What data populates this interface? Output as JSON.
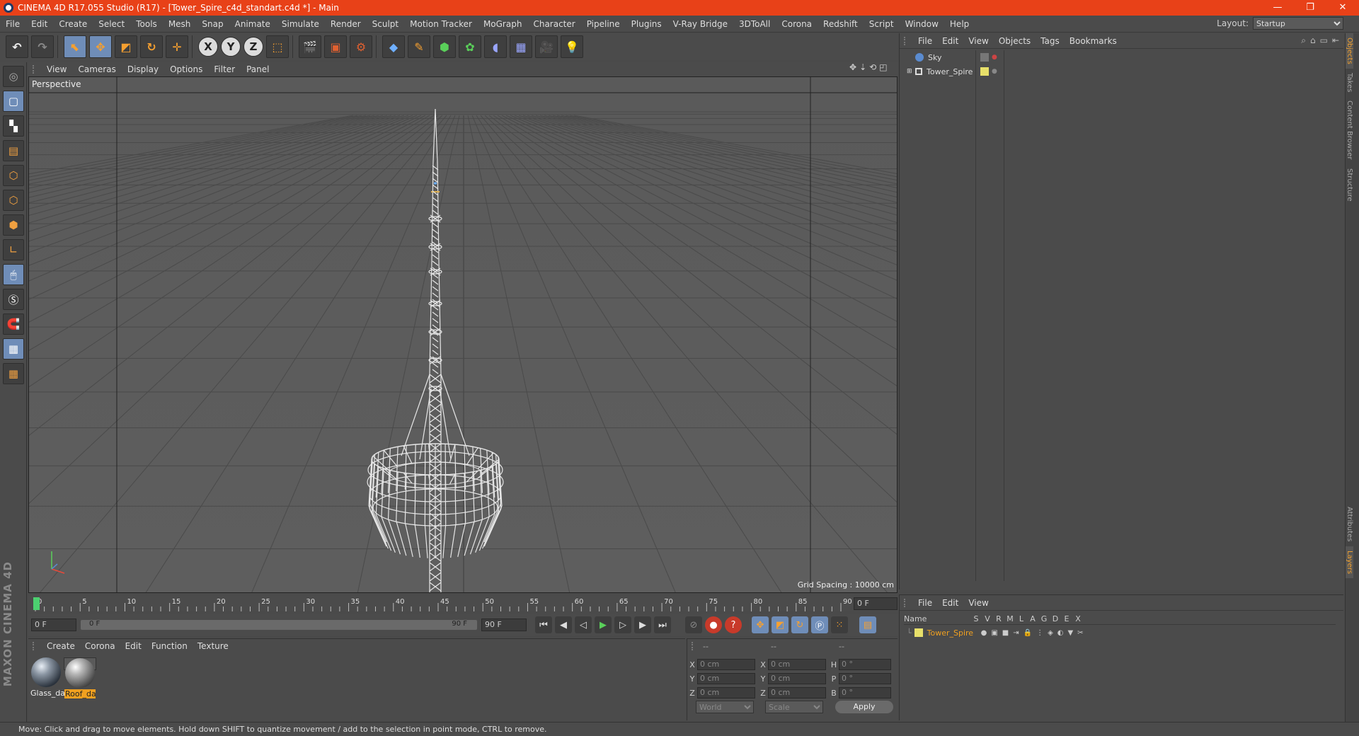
{
  "window": {
    "title": "CINEMA 4D R17.055 Studio (R17) - [Tower_Spire_c4d_standart.c4d *] - Main",
    "controls": [
      "—",
      "❐",
      "✕"
    ]
  },
  "menu": [
    "File",
    "Edit",
    "Create",
    "Select",
    "Tools",
    "Mesh",
    "Snap",
    "Animate",
    "Simulate",
    "Render",
    "Sculpt",
    "Motion Tracker",
    "MoGraph",
    "Character",
    "Pipeline",
    "Plugins",
    "V-Ray Bridge",
    "3DToAll",
    "Corona",
    "Redshift",
    "Script",
    "Window",
    "Help"
  ],
  "layout": {
    "label": "Layout:",
    "value": "Startup"
  },
  "toolbar": {
    "axis_x": "X",
    "axis_y": "Y",
    "axis_z": "Z"
  },
  "viewport": {
    "menu": [
      "View",
      "Cameras",
      "Display",
      "Options",
      "Filter",
      "Panel"
    ],
    "label": "Perspective",
    "grid_spacing": "Grid Spacing : 10000 cm"
  },
  "timeline": {
    "ticks": [
      "0",
      "5",
      "10",
      "15",
      "20",
      "25",
      "30",
      "35",
      "40",
      "45",
      "50",
      "55",
      "60",
      "65",
      "70",
      "75",
      "80",
      "85",
      "90"
    ],
    "current_frame": "0 F",
    "start_field": "0 F",
    "range_start": "0 F",
    "range_end": "90 F",
    "end_field": "90 F"
  },
  "materials": {
    "menu": [
      "Create",
      "Corona",
      "Edit",
      "Function",
      "Texture"
    ],
    "items": [
      {
        "name": "Glass_da"
      },
      {
        "name": "Roof_da"
      }
    ]
  },
  "coordinates": {
    "header": [
      "--",
      "--",
      "--"
    ],
    "rows": [
      {
        "a": "X",
        "av": "0 cm",
        "b": "X",
        "bv": "0 cm",
        "c": "H",
        "cv": "0 °"
      },
      {
        "a": "Y",
        "av": "0 cm",
        "b": "Y",
        "bv": "0 cm",
        "c": "P",
        "cv": "0 °"
      },
      {
        "a": "Z",
        "av": "0 cm",
        "b": "Z",
        "bv": "0 cm",
        "c": "B",
        "cv": "0 °"
      }
    ],
    "mode1": "World",
    "mode2": "Scale",
    "apply": "Apply"
  },
  "object_manager": {
    "menu": [
      "File",
      "Edit",
      "View",
      "Objects",
      "Tags",
      "Bookmarks"
    ],
    "objects": [
      {
        "name": "Sky"
      },
      {
        "name": "Tower_Spire"
      }
    ]
  },
  "layers": {
    "menu": [
      "File",
      "Edit",
      "View"
    ],
    "columns": [
      "Name",
      "S",
      "V",
      "R",
      "M",
      "L",
      "A",
      "G",
      "D",
      "E",
      "X"
    ],
    "rows": [
      {
        "name": "Tower_Spire"
      }
    ]
  },
  "side_tabs": [
    "Objects",
    "Takes",
    "Content Browser",
    "Structure",
    "Attributes",
    "Layers"
  ],
  "status": "Move: Click and drag to move elements. Hold down SHIFT to quantize movement / add to the selection in point mode, CTRL to remove.",
  "brand": "MAXON CINEMA 4D",
  "colors": {
    "titlebar": "#e84118",
    "accent": "#f0a020",
    "tool_active": "#6f8db8"
  }
}
